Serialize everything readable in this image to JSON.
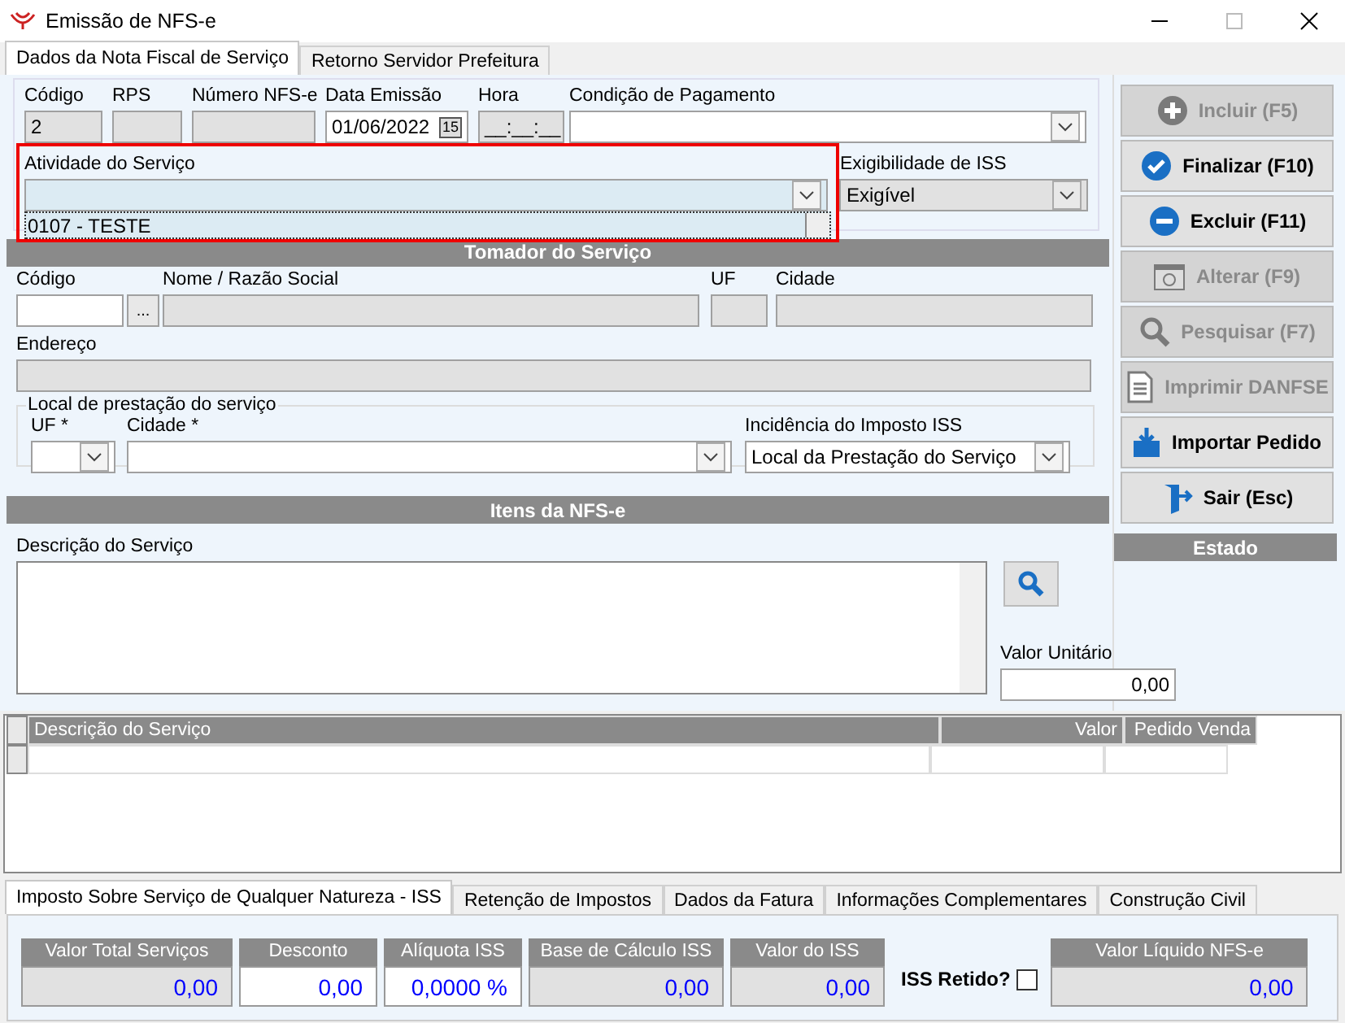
{
  "window": {
    "title": "Emissão de NFS-e"
  },
  "tabs": [
    {
      "label": "Dados da Nota Fiscal de Serviço",
      "selected": true
    },
    {
      "label": "Retorno Servidor Prefeitura",
      "selected": false
    }
  ],
  "nota": {
    "fields": [
      {
        "label": "Código",
        "value": "2",
        "disabled": true
      },
      {
        "label": "RPS",
        "disabled": true
      },
      {
        "label": "Número NFS-e",
        "disabled": true
      },
      {
        "label": "Data Emissão",
        "value": "01/06/2022",
        "disabled": false,
        "calendar_button": "15"
      },
      {
        "label": "Hora",
        "value": "__:__:__",
        "disabled": true
      }
    ],
    "condicao": {
      "label": "Condição de Pagamento"
    },
    "atividade": {
      "label": "Atividade do Serviço",
      "list_item": "0107 - TESTE",
      "highlighted": true
    },
    "exigibilidade": {
      "label": "Exigibilidade de ISS",
      "value": "Exigível"
    }
  },
  "tomador": {
    "title": "Tomador do Serviço",
    "codigo": {
      "label": "Código",
      "browse": "..."
    },
    "nome": {
      "label": "Nome / Razão Social"
    },
    "uf": {
      "label": "UF"
    },
    "cidade": {
      "label": "Cidade"
    },
    "endereco": {
      "label": "Endereço"
    },
    "local": {
      "title": "Local de prestação do serviço",
      "uf": {
        "label": "UF *"
      },
      "cidade": {
        "label": "Cidade *"
      },
      "incidencia": {
        "label": "Incidência do Imposto ISS",
        "value": "Local da Prestação do Serviço"
      }
    }
  },
  "itens": {
    "title": "Itens da NFS-e",
    "descricao": {
      "label": "Descrição do Serviço"
    },
    "valor_unitario": {
      "label": "Valor Unitário",
      "value": "0,00"
    },
    "table": {
      "columns": [
        "Descrição do Serviço",
        "Valor",
        "Pedido Venda"
      ]
    }
  },
  "actions": [
    {
      "label": "Incluir (F5)",
      "disabled": true
    },
    {
      "label": "Finalizar (F10)",
      "disabled": false
    },
    {
      "label": "Excluir (F11)",
      "disabled": false
    },
    {
      "label": "Alterar (F9)",
      "disabled": true
    },
    {
      "label": "Pesquisar (F7)",
      "disabled": true
    },
    {
      "label": "Imprimir DANFSE",
      "disabled": true
    },
    {
      "label": "Importar Pedido",
      "disabled": false
    },
    {
      "label": "Sair (Esc)",
      "disabled": false
    }
  ],
  "estado": {
    "title": "Estado"
  },
  "bottom_tabs": [
    {
      "label": "Imposto Sobre Serviço de Qualquer Natureza - ISS",
      "selected": true
    },
    {
      "label": "Retenção de Impostos",
      "selected": false
    },
    {
      "label": "Dados da Fatura",
      "selected": false
    },
    {
      "label": "Informações Complementares",
      "selected": false
    },
    {
      "label": "Construção Civil",
      "selected": false
    }
  ],
  "totals": [
    {
      "label": "Valor Total Serviços",
      "value": "0,00",
      "editable": false
    },
    {
      "label": "Desconto",
      "value": "0,00",
      "editable": true
    },
    {
      "label": "Alíquota ISS",
      "value": "0,0000 %",
      "editable": true
    },
    {
      "label": "Base de Cálculo ISS",
      "value": "0,00",
      "editable": false
    },
    {
      "label": "Valor do ISS",
      "value": "0,00",
      "editable": false
    }
  ],
  "iss_retido": {
    "label": "ISS Retido?",
    "checked": false
  },
  "valor_liquido": {
    "label": "Valor Líquido NFS-e",
    "value": "0,00",
    "editable": false
  }
}
